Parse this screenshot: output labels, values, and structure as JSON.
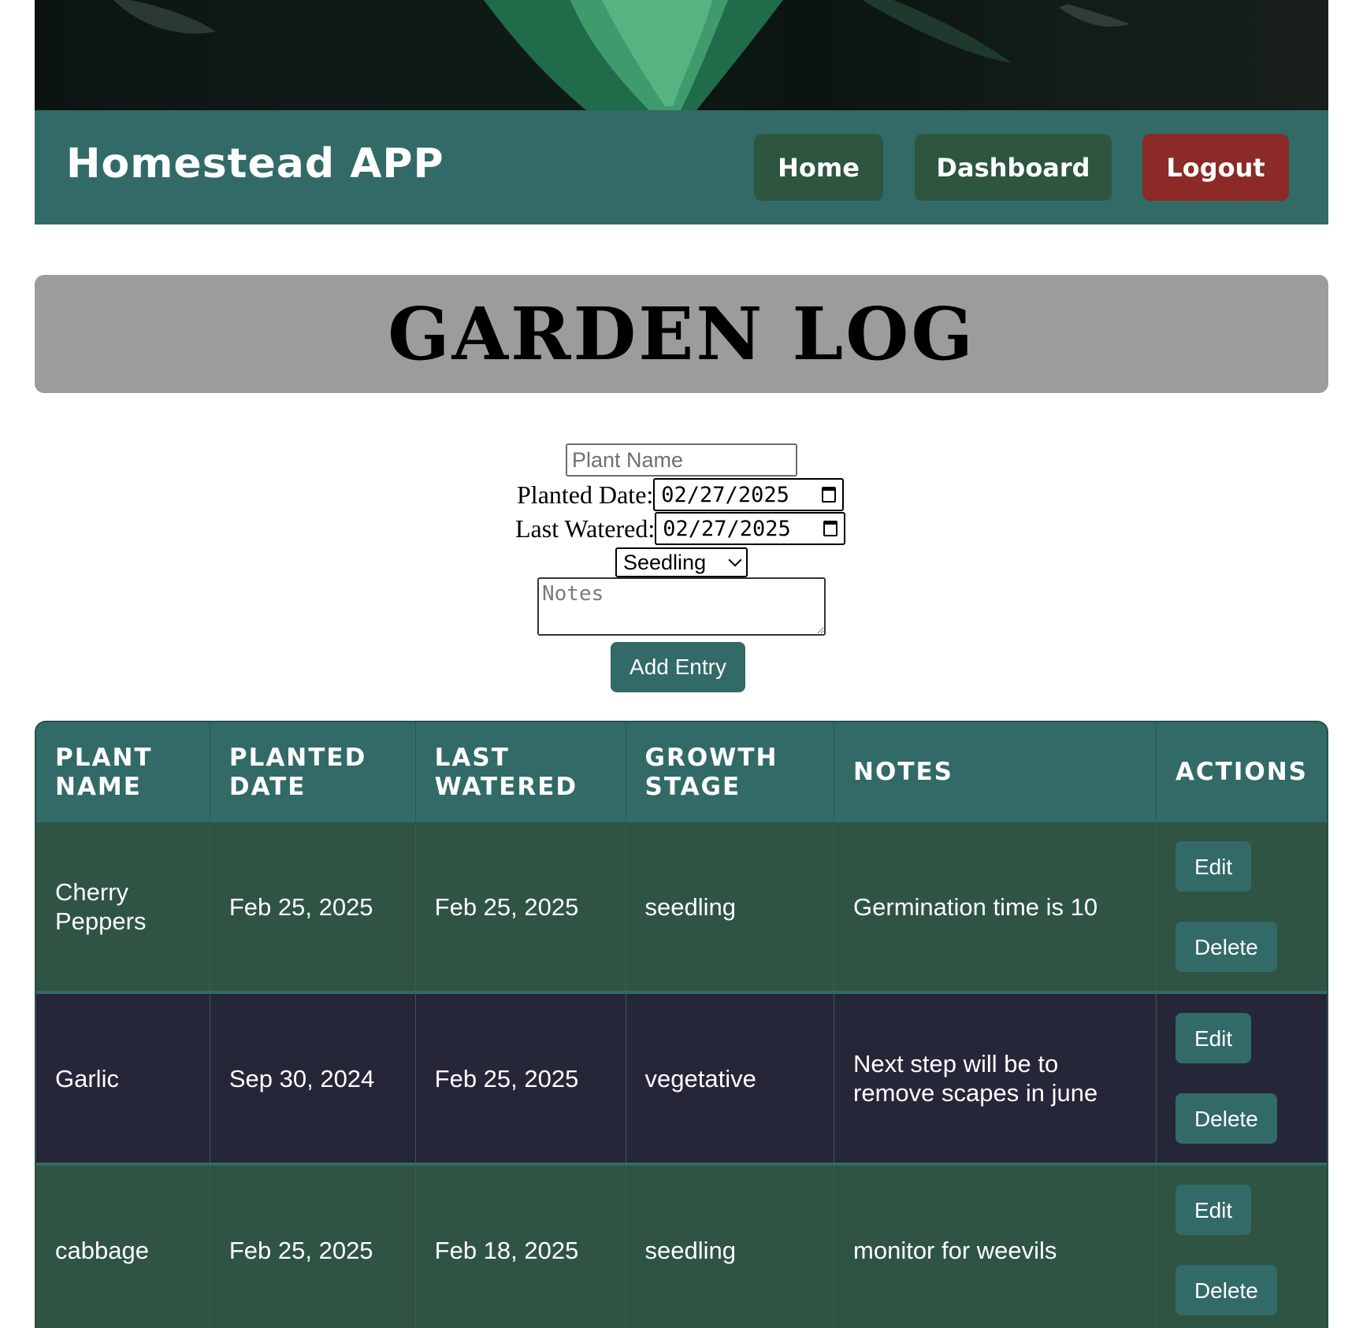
{
  "header": {
    "brand": "Homestead APP",
    "nav": {
      "home": "Home",
      "dashboard": "Dashboard",
      "logout": "Logout"
    }
  },
  "colors": {
    "accent": "#326a68",
    "nav_button": "#2d5540",
    "logout": "#8b2a27",
    "row_green": "#2f5443",
    "row_navy": "#252638",
    "banner": "#9c9c9c"
  },
  "page_title": "GARDEN LOG",
  "form": {
    "plant_name_placeholder": "Plant Name",
    "planted_date_label": "Planted Date:",
    "planted_date_value": "02/27/2025",
    "last_watered_label": "Last Watered:",
    "last_watered_value": "02/27/2025",
    "growth_stage_value": "Seedling",
    "notes_placeholder": "Notes",
    "submit_label": "Add Entry"
  },
  "table": {
    "headers": [
      "PLANT NAME",
      "PLANTED DATE",
      "LAST WATERED",
      "GROWTH STAGE",
      "NOTES",
      "ACTIONS"
    ],
    "rows": [
      {
        "plant_name": "Cherry Peppers",
        "planted_date": "Feb 25, 2025",
        "last_watered": "Feb 25, 2025",
        "growth_stage": "seedling",
        "notes": "Germination time is 10",
        "edit_label": "Edit",
        "delete_label": "Delete"
      },
      {
        "plant_name": "Garlic",
        "planted_date": "Sep 30, 2024",
        "last_watered": "Feb 25, 2025",
        "growth_stage": "vegetative",
        "notes": "Next step will be to remove scapes in june",
        "edit_label": "Edit",
        "delete_label": "Delete"
      },
      {
        "plant_name": "cabbage",
        "planted_date": "Feb 25, 2025",
        "last_watered": "Feb 18, 2025",
        "growth_stage": "seedling",
        "notes": "monitor for weevils",
        "edit_label": "Edit",
        "delete_label": "Delete"
      }
    ]
  }
}
